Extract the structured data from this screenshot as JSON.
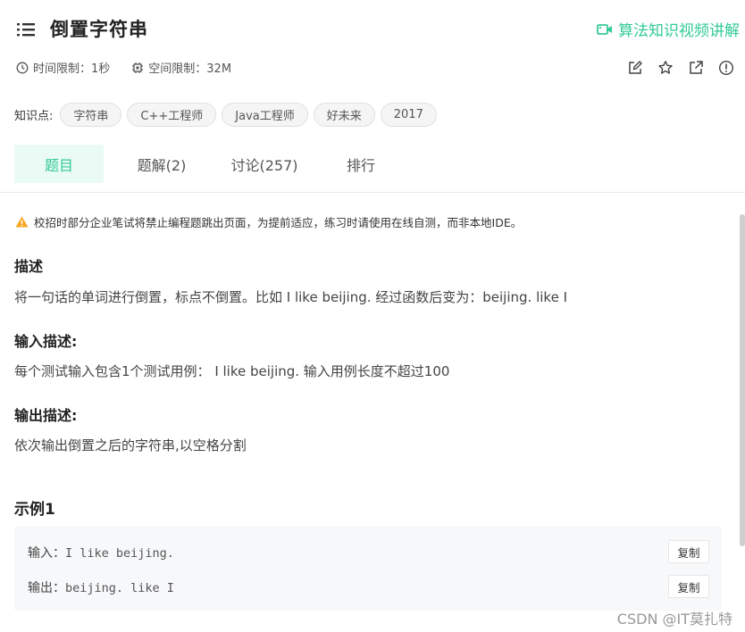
{
  "header": {
    "title": "倒置字符串",
    "video_link": "算法知识视频讲解",
    "time_limit": "时间限制：1秒",
    "space_limit": "空间限制：32M"
  },
  "tags": {
    "label": "知识点:",
    "items": [
      "字符串",
      "C++工程师",
      "Java工程师",
      "好未来",
      "2017"
    ]
  },
  "tabs": [
    "题目",
    "题解(2)",
    "讨论(257)",
    "排行"
  ],
  "notice": "校招时部分企业笔试将禁止编程题跳出页面，为提前适应，练习时请使用在线自测，而非本地IDE。",
  "sections": {
    "desc_title": "描述",
    "desc_text": "将一句话的单词进行倒置，标点不倒置。比如 I like beijing. 经过函数后变为：beijing. like I",
    "input_title": "输入描述:",
    "input_text": "每个测试输入包含1个测试用例： I like beijing. 输入用例长度不超过100",
    "output_title": "输出描述:",
    "output_text": "依次输出倒置之后的字符串,以空格分割"
  },
  "example": {
    "title": "示例1",
    "input_label": "输入：",
    "input_value": "I like beijing.",
    "output_label": "输出：",
    "output_value": "beijing. like I",
    "copy_label": "复制"
  },
  "watermark": "CSDN @IT莫扎特",
  "colors": {
    "accent": "#32ca99",
    "warn": "#f5a623"
  }
}
